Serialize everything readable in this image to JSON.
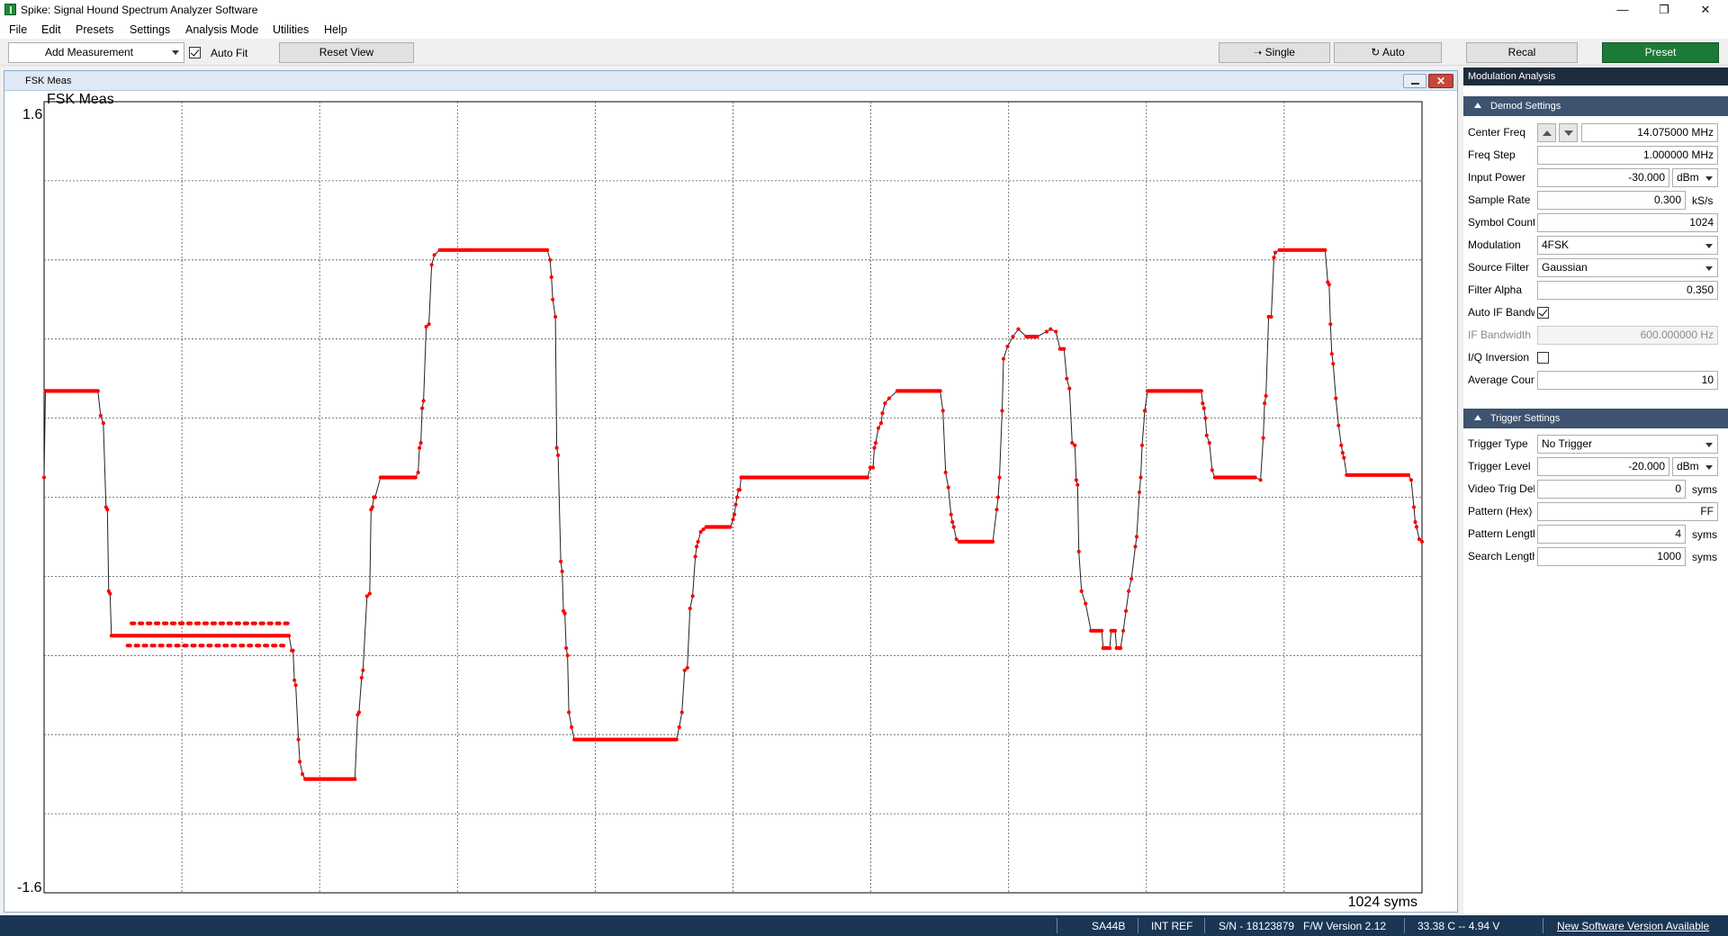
{
  "window": {
    "title": "Spike: Signal Hound Spectrum Analyzer Software"
  },
  "menu": [
    "File",
    "Edit",
    "Presets",
    "Settings",
    "Analysis Mode",
    "Utilities",
    "Help"
  ],
  "toolbar": {
    "add_measurement": "Add Measurement",
    "auto_fit_label": "Auto Fit",
    "auto_fit_checked": true,
    "reset_view": "Reset View",
    "single": "Single",
    "auto": "Auto",
    "recal": "Recal",
    "preset": "Preset",
    "preset_color": "#1d7a36"
  },
  "plot": {
    "window_label": "FSK Meas",
    "title": "FSK Meas",
    "y_max_label": "1.6",
    "y_min_label": "-1.6",
    "x_label": "1024 syms",
    "trace_color": "#ff0000"
  },
  "chart_data": {
    "type": "line",
    "title": "FSK Meas",
    "ylim": [
      -1.6,
      1.6
    ],
    "xlim": [
      0,
      1024
    ],
    "x_unit": "syms",
    "grid": true,
    "symbol_levels": [
      -1.0,
      -0.333,
      0.333,
      1.0
    ],
    "series": [
      {
        "points": [
          [
            0,
            0.08
          ],
          [
            1,
            0.43
          ],
          [
            40,
            0.43
          ],
          [
            42,
            0.33
          ],
          [
            44,
            0.3
          ],
          [
            46,
            -0.04
          ],
          [
            47,
            -0.05
          ],
          [
            48,
            -0.38
          ],
          [
            49,
            -0.39
          ],
          [
            50,
            -0.56
          ],
          [
            72,
            -0.56
          ],
          [
            84,
            -0.56
          ],
          [
            100,
            -0.56
          ],
          [
            120,
            -0.56
          ],
          [
            140,
            -0.56
          ],
          [
            160,
            -0.56
          ],
          [
            182,
            -0.56
          ],
          [
            184,
            -0.62
          ],
          [
            185,
            -0.62
          ],
          [
            186,
            -0.74
          ],
          [
            187,
            -0.76
          ],
          [
            189,
            -0.98
          ],
          [
            190,
            -1.07
          ],
          [
            192,
            -1.12
          ],
          [
            194,
            -1.14
          ],
          [
            208,
            -1.14
          ],
          [
            220,
            -1.14
          ],
          [
            231,
            -1.14
          ],
          [
            233,
            -0.88
          ],
          [
            234,
            -0.87
          ],
          [
            236,
            -0.73
          ],
          [
            237,
            -0.7
          ],
          [
            240,
            -0.4
          ],
          [
            242,
            -0.39
          ],
          [
            243,
            -0.05
          ],
          [
            244,
            -0.04
          ],
          [
            245,
            0.0
          ],
          [
            246,
            0.0
          ],
          [
            250,
            0.08
          ],
          [
            270,
            0.08
          ],
          [
            276,
            0.08
          ],
          [
            278,
            0.1
          ],
          [
            279,
            0.2
          ],
          [
            280,
            0.22
          ],
          [
            281,
            0.36
          ],
          [
            282,
            0.39
          ],
          [
            284,
            0.69
          ],
          [
            286,
            0.7
          ],
          [
            288,
            0.94
          ],
          [
            290,
            0.98
          ],
          [
            294,
            1.0
          ],
          [
            310,
            1.0
          ],
          [
            330,
            1.0
          ],
          [
            350,
            1.0
          ],
          [
            374,
            1.0
          ],
          [
            376,
            0.96
          ],
          [
            377,
            0.89
          ],
          [
            378,
            0.8
          ],
          [
            380,
            0.73
          ],
          [
            381,
            0.2
          ],
          [
            382,
            0.17
          ],
          [
            384,
            -0.26
          ],
          [
            385,
            -0.3
          ],
          [
            386,
            -0.46
          ],
          [
            387,
            -0.47
          ],
          [
            388,
            -0.61
          ],
          [
            389,
            -0.64
          ],
          [
            390,
            -0.87
          ],
          [
            392,
            -0.93
          ],
          [
            394,
            -0.98
          ],
          [
            400,
            -0.98
          ],
          [
            420,
            -0.98
          ],
          [
            440,
            -0.98
          ],
          [
            460,
            -0.98
          ],
          [
            470,
            -0.98
          ],
          [
            472,
            -0.93
          ],
          [
            474,
            -0.87
          ],
          [
            476,
            -0.7
          ],
          [
            478,
            -0.69
          ],
          [
            480,
            -0.45
          ],
          [
            482,
            -0.4
          ],
          [
            484,
            -0.24
          ],
          [
            485,
            -0.2
          ],
          [
            486,
            -0.18
          ],
          [
            488,
            -0.14
          ],
          [
            490,
            -0.13
          ],
          [
            492,
            -0.12
          ],
          [
            510,
            -0.12
          ],
          [
            512,
            -0.09
          ],
          [
            513,
            -0.07
          ],
          [
            514,
            -0.03
          ],
          [
            515,
            0.0
          ],
          [
            516,
            0.03
          ],
          [
            517,
            0.03
          ],
          [
            518,
            0.08
          ],
          [
            540,
            0.08
          ],
          [
            560,
            0.08
          ],
          [
            576,
            0.08
          ],
          [
            600,
            0.08
          ],
          [
            612,
            0.08
          ],
          [
            614,
            0.12
          ],
          [
            616,
            0.12
          ],
          [
            617,
            0.2
          ],
          [
            618,
            0.22
          ],
          [
            620,
            0.28
          ],
          [
            622,
            0.3
          ],
          [
            623,
            0.34
          ],
          [
            625,
            0.38
          ],
          [
            628,
            0.4
          ],
          [
            634,
            0.43
          ],
          [
            646,
            0.43
          ],
          [
            660,
            0.43
          ],
          [
            666,
            0.43
          ],
          [
            668,
            0.35
          ],
          [
            670,
            0.1
          ],
          [
            672,
            0.04
          ],
          [
            674,
            -0.07
          ],
          [
            675,
            -0.1
          ],
          [
            676,
            -0.12
          ],
          [
            678,
            -0.17
          ],
          [
            680,
            -0.18
          ],
          [
            690,
            -0.18
          ],
          [
            705,
            -0.18
          ],
          [
            708,
            -0.05
          ],
          [
            709,
            0.0
          ],
          [
            710,
            0.08
          ],
          [
            712,
            0.35
          ],
          [
            713,
            0.56
          ],
          [
            716,
            0.61
          ],
          [
            720,
            0.65
          ],
          [
            724,
            0.68
          ],
          [
            730,
            0.65
          ],
          [
            738,
            0.65
          ],
          [
            745,
            0.67
          ],
          [
            748,
            0.68
          ],
          [
            752,
            0.67
          ],
          [
            755,
            0.6
          ],
          [
            758,
            0.6
          ],
          [
            760,
            0.48
          ],
          [
            762,
            0.44
          ],
          [
            764,
            0.22
          ],
          [
            766,
            0.21
          ],
          [
            767,
            0.07
          ],
          [
            768,
            0.05
          ],
          [
            769,
            -0.22
          ],
          [
            771,
            -0.38
          ],
          [
            774,
            -0.43
          ],
          [
            778,
            -0.54
          ],
          [
            786,
            -0.54
          ],
          [
            787,
            -0.61
          ],
          [
            792,
            -0.61
          ],
          [
            793,
            -0.54
          ],
          [
            796,
            -0.54
          ],
          [
            797,
            -0.61
          ],
          [
            800,
            -0.61
          ],
          [
            802,
            -0.54
          ],
          [
            804,
            -0.46
          ],
          [
            806,
            -0.38
          ],
          [
            808,
            -0.33
          ],
          [
            811,
            -0.2
          ],
          [
            812,
            -0.16
          ],
          [
            814,
            0.02
          ],
          [
            815,
            0.08
          ],
          [
            816,
            0.21
          ],
          [
            818,
            0.35
          ],
          [
            820,
            0.43
          ],
          [
            860,
            0.43
          ],
          [
            861,
            0.38
          ],
          [
            862,
            0.36
          ],
          [
            863,
            0.32
          ],
          [
            864,
            0.25
          ],
          [
            866,
            0.22
          ],
          [
            868,
            0.11
          ],
          [
            870,
            0.08
          ],
          [
            900,
            0.08
          ],
          [
            904,
            0.07
          ],
          [
            906,
            0.24
          ],
          [
            907,
            0.38
          ],
          [
            908,
            0.41
          ],
          [
            910,
            0.73
          ],
          [
            912,
            0.73
          ],
          [
            914,
            0.97
          ],
          [
            915,
            0.99
          ],
          [
            918,
            1.0
          ],
          [
            936,
            1.0
          ],
          [
            948,
            1.0
          ],
          [
            952,
            1.0
          ],
          [
            954,
            0.87
          ],
          [
            955,
            0.86
          ],
          [
            956,
            0.7
          ],
          [
            957,
            0.58
          ],
          [
            958,
            0.54
          ],
          [
            960,
            0.4
          ],
          [
            962,
            0.29
          ],
          [
            964,
            0.21
          ],
          [
            965,
            0.18
          ],
          [
            966,
            0.16
          ],
          [
            968,
            0.09
          ],
          [
            1000,
            0.09
          ],
          [
            1014,
            0.09
          ],
          [
            1016,
            0.07
          ],
          [
            1018,
            -0.04
          ],
          [
            1019,
            -0.1
          ],
          [
            1020,
            -0.12
          ],
          [
            1022,
            -0.17
          ],
          [
            1024,
            -0.18
          ]
        ]
      }
    ]
  },
  "panel": {
    "title": "Modulation Analysis",
    "demod_header": "Demod Settings",
    "trigger_header": "Trigger Settings",
    "center_freq": {
      "label": "Center Freq",
      "value": "14.075000 MHz"
    },
    "freq_step": {
      "label": "Freq Step",
      "value": "1.000000 MHz"
    },
    "input_power": {
      "label": "Input Power",
      "value": "-30.000",
      "unit": "dBm"
    },
    "sample_rate": {
      "label": "Sample Rate",
      "value": "0.300",
      "unit": "kS/s"
    },
    "symbol_count": {
      "label": "Symbol Count",
      "value": "1024"
    },
    "modulation": {
      "label": "Modulation",
      "value": "4FSK"
    },
    "source_filter": {
      "label": "Source Filter",
      "value": "Gaussian"
    },
    "filter_alpha": {
      "label": "Filter Alpha",
      "value": "0.350"
    },
    "auto_if_bw": {
      "label": "Auto IF Bandwidth",
      "checked": true
    },
    "if_bandwidth": {
      "label": "IF Bandwidth",
      "value": "600.000000 Hz"
    },
    "iq_inversion": {
      "label": "I/Q Inversion",
      "checked": false
    },
    "average_count": {
      "label": "Average Count",
      "value": "10"
    },
    "trigger_type": {
      "label": "Trigger Type",
      "value": "No Trigger"
    },
    "trigger_level": {
      "label": "Trigger Level",
      "value": "-20.000",
      "unit": "dBm"
    },
    "video_trig_delay": {
      "label": "Video Trig Delay",
      "value": "0",
      "unit": "syms"
    },
    "pattern_hex": {
      "label": "Pattern (Hex)",
      "value": "FF"
    },
    "pattern_length": {
      "label": "Pattern Length",
      "value": "4",
      "unit": "syms"
    },
    "search_length": {
      "label": "Search Length",
      "value": "1000",
      "unit": "syms"
    }
  },
  "status": {
    "device": "SA44B",
    "ref": "INT REF",
    "serial": "S/N - 18123879",
    "fw": "F/W Version 2.12",
    "temp_voltage": "33.38 C -- 4.94 V",
    "update": "New Software Version Available"
  }
}
